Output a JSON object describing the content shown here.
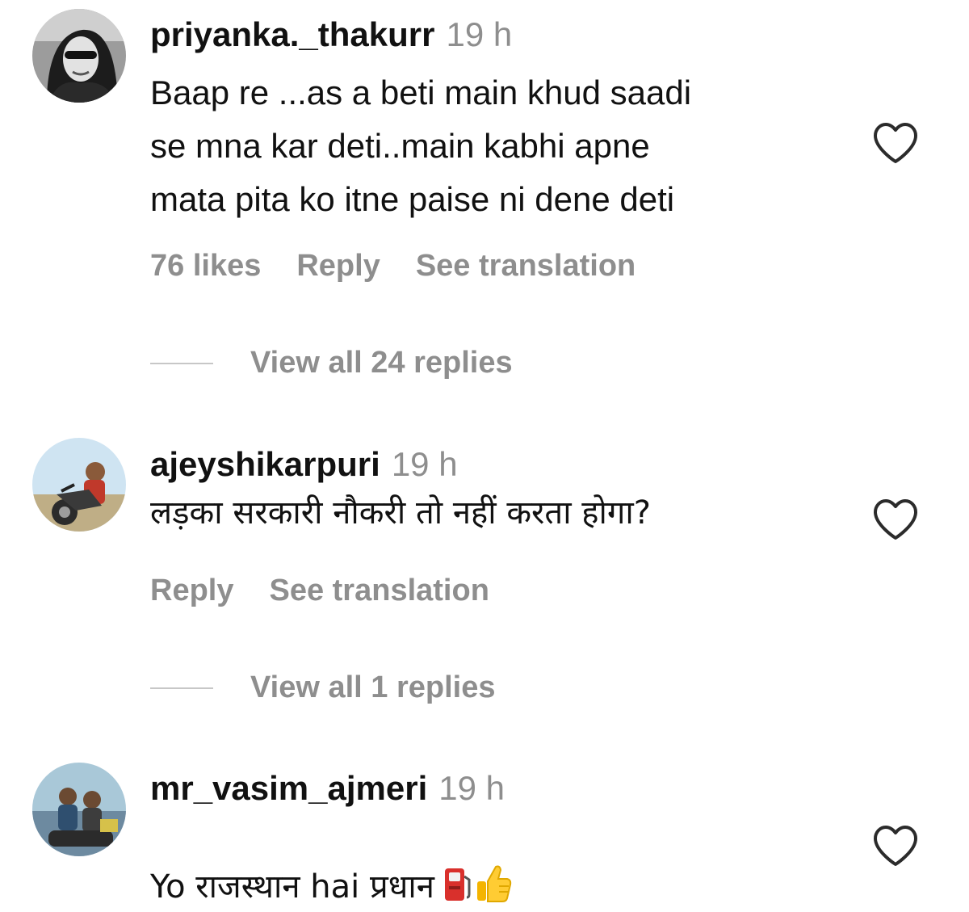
{
  "comments": [
    {
      "username": "priyanka._thakurr",
      "time": "19 h",
      "text": "Baap re ...as a beti main khud saadi\nse mna kar deti..main kabhi apne\nmata pita ko itne paise ni dene deti",
      "likes": "76 likes",
      "reply_label": "Reply",
      "translate_label": "See translation",
      "view_replies": "View all 24 replies"
    },
    {
      "username": "ajeyshikarpuri",
      "time": "19 h",
      "text": "लड़का सरकारी नौकरी तो नहीं करता होगा?",
      "reply_label": "Reply",
      "translate_label": "See translation",
      "view_replies": "View all 1 replies"
    },
    {
      "username": "mr_vasim_ajmeri",
      "time": "19 h",
      "text": "Yo राजस्थान hai प्रधान",
      "emojis": [
        "fuel-pump-emoji",
        "thumbs-up-emoji"
      ]
    }
  ],
  "icons": {
    "like": "heart-outline-icon"
  },
  "colors": {
    "text": "#111111",
    "muted": "#8e8e8e",
    "divider": "#c7c7c7"
  }
}
